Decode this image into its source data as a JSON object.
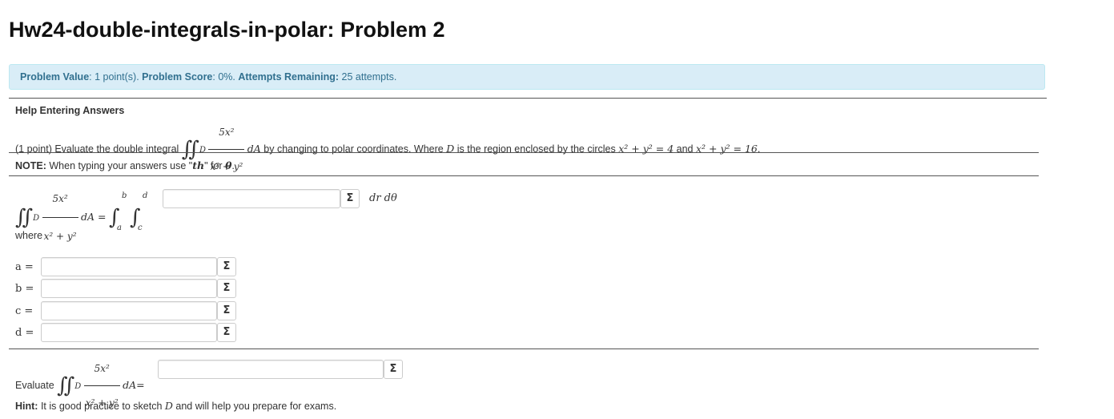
{
  "page": {
    "title": "Hw24-double-integrals-in-polar: Problem 2"
  },
  "status": {
    "value_label": "Problem Value",
    "value_text": ": 1 point(s). ",
    "score_label": "Problem Score",
    "score_text": ": 0%. ",
    "attempts_label": "Attempts Remaining:",
    "attempts_text": " 25 attempts."
  },
  "help": {
    "link": "Help Entering Answers"
  },
  "problem": {
    "intro": "(1 point) Evaluate the double integral",
    "integrand_num": "5x²",
    "integrand_den": "x² + y²",
    "dA": "dA",
    "region_sub": "D",
    "after_text": " by changing to polar coordinates. Where ",
    "region_var": "D",
    "region_text": " is the region enclosed by the circles ",
    "circle1": "x² + y² = 4",
    "and_text": " and ",
    "circle2": "x² + y² = 16",
    "end_text": "."
  },
  "note": {
    "label": "NOTE:",
    "text": " When typing your answers use \"",
    "code": "th",
    "text2": "\" for ",
    "theta": "θ",
    "end": "."
  },
  "main_integral": {
    "lhs_dA": "dA =",
    "lim_b": "b",
    "lim_a": "a",
    "lim_d": "d",
    "lim_c": "c",
    "suffix": "dr dθ",
    "input_value": ""
  },
  "where_label": "where",
  "limits": [
    {
      "var": "a =",
      "value": ""
    },
    {
      "var": "b =",
      "value": ""
    },
    {
      "var": "c =",
      "value": ""
    },
    {
      "var": "d =",
      "value": ""
    }
  ],
  "evaluate": {
    "label": "Evaluate",
    "dA": "dA=",
    "value": ""
  },
  "hint": {
    "label": "Hint:",
    "text1": " It is good practice to sketch ",
    "var": "D",
    "text2": " and will help you prepare for exams."
  },
  "icons": {
    "equation_editor": "Σ"
  },
  "colors": {
    "status_bg": "#d9edf7",
    "status_text": "#31708f"
  }
}
